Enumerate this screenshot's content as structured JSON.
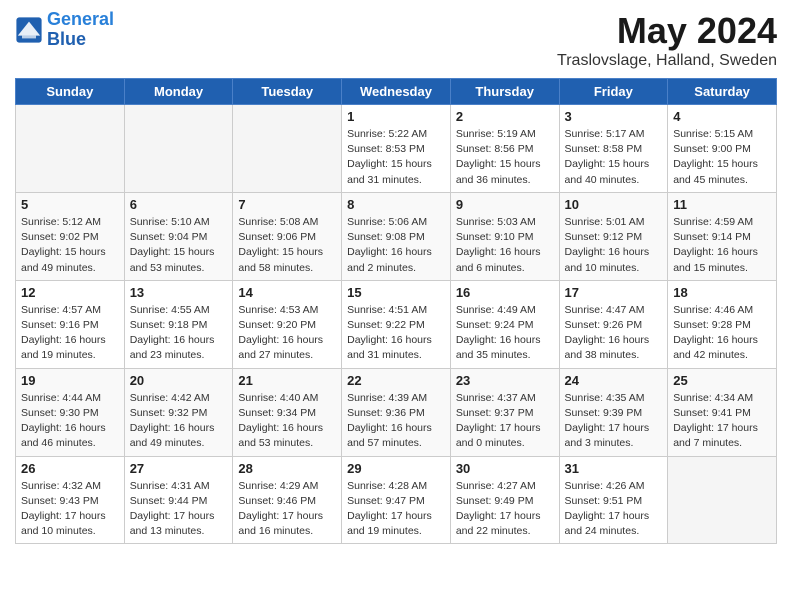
{
  "header": {
    "logo_line1": "General",
    "logo_line2": "Blue",
    "title": "May 2024",
    "subtitle": "Traslovslage, Halland, Sweden"
  },
  "days_of_week": [
    "Sunday",
    "Monday",
    "Tuesday",
    "Wednesday",
    "Thursday",
    "Friday",
    "Saturday"
  ],
  "weeks": [
    [
      {
        "day": "",
        "empty": true
      },
      {
        "day": "",
        "empty": true
      },
      {
        "day": "",
        "empty": true
      },
      {
        "day": "1",
        "info": "Sunrise: 5:22 AM\nSunset: 8:53 PM\nDaylight: 15 hours\nand 31 minutes."
      },
      {
        "day": "2",
        "info": "Sunrise: 5:19 AM\nSunset: 8:56 PM\nDaylight: 15 hours\nand 36 minutes."
      },
      {
        "day": "3",
        "info": "Sunrise: 5:17 AM\nSunset: 8:58 PM\nDaylight: 15 hours\nand 40 minutes."
      },
      {
        "day": "4",
        "info": "Sunrise: 5:15 AM\nSunset: 9:00 PM\nDaylight: 15 hours\nand 45 minutes."
      }
    ],
    [
      {
        "day": "5",
        "info": "Sunrise: 5:12 AM\nSunset: 9:02 PM\nDaylight: 15 hours\nand 49 minutes."
      },
      {
        "day": "6",
        "info": "Sunrise: 5:10 AM\nSunset: 9:04 PM\nDaylight: 15 hours\nand 53 minutes."
      },
      {
        "day": "7",
        "info": "Sunrise: 5:08 AM\nSunset: 9:06 PM\nDaylight: 15 hours\nand 58 minutes."
      },
      {
        "day": "8",
        "info": "Sunrise: 5:06 AM\nSunset: 9:08 PM\nDaylight: 16 hours\nand 2 minutes."
      },
      {
        "day": "9",
        "info": "Sunrise: 5:03 AM\nSunset: 9:10 PM\nDaylight: 16 hours\nand 6 minutes."
      },
      {
        "day": "10",
        "info": "Sunrise: 5:01 AM\nSunset: 9:12 PM\nDaylight: 16 hours\nand 10 minutes."
      },
      {
        "day": "11",
        "info": "Sunrise: 4:59 AM\nSunset: 9:14 PM\nDaylight: 16 hours\nand 15 minutes."
      }
    ],
    [
      {
        "day": "12",
        "info": "Sunrise: 4:57 AM\nSunset: 9:16 PM\nDaylight: 16 hours\nand 19 minutes."
      },
      {
        "day": "13",
        "info": "Sunrise: 4:55 AM\nSunset: 9:18 PM\nDaylight: 16 hours\nand 23 minutes."
      },
      {
        "day": "14",
        "info": "Sunrise: 4:53 AM\nSunset: 9:20 PM\nDaylight: 16 hours\nand 27 minutes."
      },
      {
        "day": "15",
        "info": "Sunrise: 4:51 AM\nSunset: 9:22 PM\nDaylight: 16 hours\nand 31 minutes."
      },
      {
        "day": "16",
        "info": "Sunrise: 4:49 AM\nSunset: 9:24 PM\nDaylight: 16 hours\nand 35 minutes."
      },
      {
        "day": "17",
        "info": "Sunrise: 4:47 AM\nSunset: 9:26 PM\nDaylight: 16 hours\nand 38 minutes."
      },
      {
        "day": "18",
        "info": "Sunrise: 4:46 AM\nSunset: 9:28 PM\nDaylight: 16 hours\nand 42 minutes."
      }
    ],
    [
      {
        "day": "19",
        "info": "Sunrise: 4:44 AM\nSunset: 9:30 PM\nDaylight: 16 hours\nand 46 minutes."
      },
      {
        "day": "20",
        "info": "Sunrise: 4:42 AM\nSunset: 9:32 PM\nDaylight: 16 hours\nand 49 minutes."
      },
      {
        "day": "21",
        "info": "Sunrise: 4:40 AM\nSunset: 9:34 PM\nDaylight: 16 hours\nand 53 minutes."
      },
      {
        "day": "22",
        "info": "Sunrise: 4:39 AM\nSunset: 9:36 PM\nDaylight: 16 hours\nand 57 minutes."
      },
      {
        "day": "23",
        "info": "Sunrise: 4:37 AM\nSunset: 9:37 PM\nDaylight: 17 hours\nand 0 minutes."
      },
      {
        "day": "24",
        "info": "Sunrise: 4:35 AM\nSunset: 9:39 PM\nDaylight: 17 hours\nand 3 minutes."
      },
      {
        "day": "25",
        "info": "Sunrise: 4:34 AM\nSunset: 9:41 PM\nDaylight: 17 hours\nand 7 minutes."
      }
    ],
    [
      {
        "day": "26",
        "info": "Sunrise: 4:32 AM\nSunset: 9:43 PM\nDaylight: 17 hours\nand 10 minutes."
      },
      {
        "day": "27",
        "info": "Sunrise: 4:31 AM\nSunset: 9:44 PM\nDaylight: 17 hours\nand 13 minutes."
      },
      {
        "day": "28",
        "info": "Sunrise: 4:29 AM\nSunset: 9:46 PM\nDaylight: 17 hours\nand 16 minutes."
      },
      {
        "day": "29",
        "info": "Sunrise: 4:28 AM\nSunset: 9:47 PM\nDaylight: 17 hours\nand 19 minutes."
      },
      {
        "day": "30",
        "info": "Sunrise: 4:27 AM\nSunset: 9:49 PM\nDaylight: 17 hours\nand 22 minutes."
      },
      {
        "day": "31",
        "info": "Sunrise: 4:26 AM\nSunset: 9:51 PM\nDaylight: 17 hours\nand 24 minutes."
      },
      {
        "day": "",
        "empty": true
      }
    ]
  ]
}
